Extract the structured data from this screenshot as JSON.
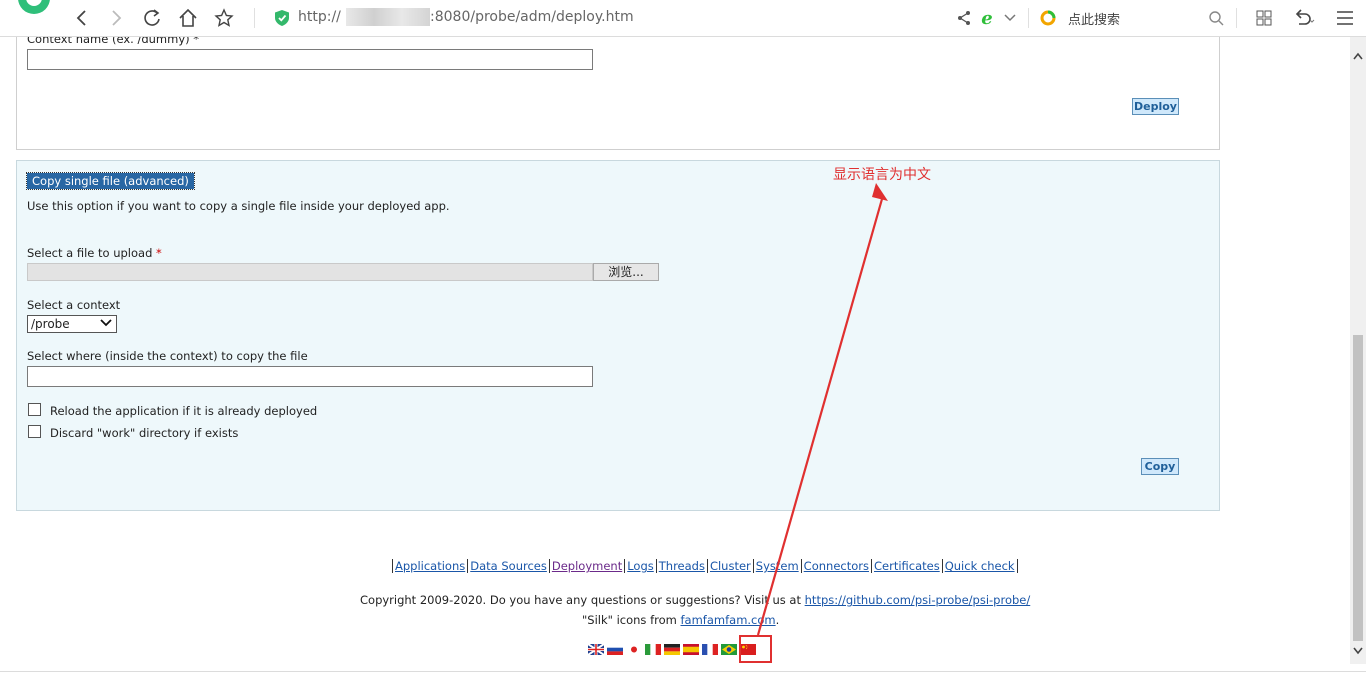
{
  "browser": {
    "url_prefix": "http://",
    "url_suffix": ":8080/probe/adm/deploy.htm",
    "search_placeholder": "点此搜索",
    "icons": [
      "back-icon",
      "forward-icon",
      "refresh-icon",
      "home-icon",
      "star-icon",
      "shield-icon",
      "share-icon",
      "ie-icon",
      "chevron-down-icon",
      "search-engine-icon",
      "search-icon",
      "apps-icon",
      "undo-icon",
      "menu-icon"
    ]
  },
  "deploy_panel": {
    "context_label": "Context name (ex. /dummy) *",
    "context_value": "",
    "deploy_button": "Deploy"
  },
  "copy_panel": {
    "title": "Copy single file (advanced)",
    "description": "Use this option if you want to copy a single file inside your deployed app.",
    "file_label": "Select a file to upload",
    "required_mark": "*",
    "browse_button": "浏览...",
    "context_label": "Select a context",
    "context_selected": "/probe",
    "where_label": "Select where (inside the context) to copy the file",
    "where_value": "",
    "reload_label": "Reload the application if it is already deployed",
    "discard_label": "Discard \"work\" directory if exists",
    "copy_button": "Copy"
  },
  "footer": {
    "nav": [
      {
        "label": "Applications"
      },
      {
        "label": "Data Sources"
      },
      {
        "label": "Deployment"
      },
      {
        "label": "Logs"
      },
      {
        "label": "Threads"
      },
      {
        "label": "Cluster"
      },
      {
        "label": "System"
      },
      {
        "label": "Connectors"
      },
      {
        "label": "Certificates"
      },
      {
        "label": "Quick check"
      }
    ],
    "copyright_text": "Copyright 2009-2020. Do you have any questions or suggestions? Visit us at ",
    "copyright_link": "https://github.com/psi-probe/psi-probe/",
    "silk_text": "\"Silk\" icons from ",
    "silk_link": "famfamfam.com",
    "silk_end": ".",
    "flags": [
      "uk",
      "ru",
      "jp",
      "it",
      "de",
      "es",
      "fr",
      "br",
      "cn"
    ]
  },
  "annotation": {
    "text": "显示语言为中文",
    "color": "#e03030"
  }
}
